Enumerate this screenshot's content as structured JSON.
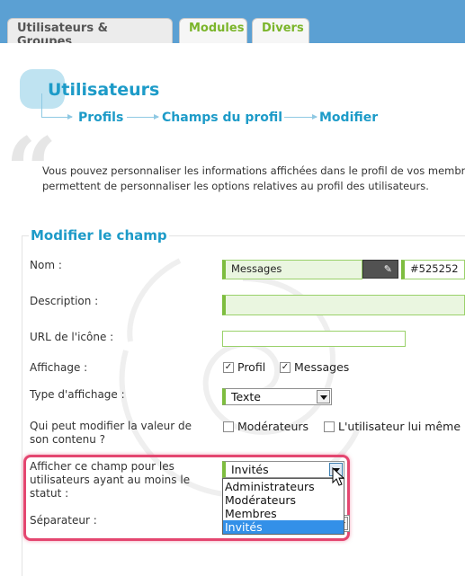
{
  "tabs": [
    {
      "label": "Utilisateurs & Groupes",
      "active": true
    },
    {
      "label": "Modules",
      "active": false
    },
    {
      "label": "Divers",
      "active": false
    }
  ],
  "header": {
    "title": "Utilisateurs",
    "breadcrumbs": [
      "Profils",
      "Champs du profil",
      "Modifier"
    ]
  },
  "description": {
    "line1": "Vous pouvez personnaliser les informations affichées dans le profil de vos membres",
    "line2": "permettent de personnaliser les options relatives au profil des utilisateurs."
  },
  "form": {
    "legend": "Modifier le champ",
    "nom": {
      "label": "Nom :",
      "value": "Messages",
      "color_value": "#525252"
    },
    "description": {
      "label": "Description :",
      "value": ""
    },
    "icon_url": {
      "label": "URL de l'icône :",
      "value": ""
    },
    "affichage": {
      "label": "Affichage :",
      "options": [
        {
          "label": "Profil",
          "checked": true
        },
        {
          "label": "Messages",
          "checked": true
        }
      ]
    },
    "type_affichage": {
      "label": "Type d'affichage :",
      "value": "Texte"
    },
    "qui_modifie": {
      "label_line1": "Qui peut modifier la valeur de",
      "label_line2": "son contenu ?",
      "options": [
        {
          "label": "Modérateurs",
          "checked": false
        },
        {
          "label": "L'utilisateur lui même",
          "checked": false
        }
      ]
    },
    "afficher_statut": {
      "label_line1": "Afficher ce champ pour les",
      "label_line2": "utilisateurs ayant au moins le",
      "label_line3": "statut :",
      "value": "Invités",
      "options": [
        "Administrateurs",
        "Modérateurs",
        "Membres",
        "Invités"
      ],
      "selected_index": 3
    },
    "separateur": {
      "label": "Séparateur :"
    }
  },
  "colors": {
    "accent_blue": "#1d9bc8",
    "accent_green": "#7ebd3f",
    "tab_green": "#7bb52b",
    "highlight": "#e44670",
    "selection": "#3390e8",
    "topbar": "#5ba0d3"
  }
}
